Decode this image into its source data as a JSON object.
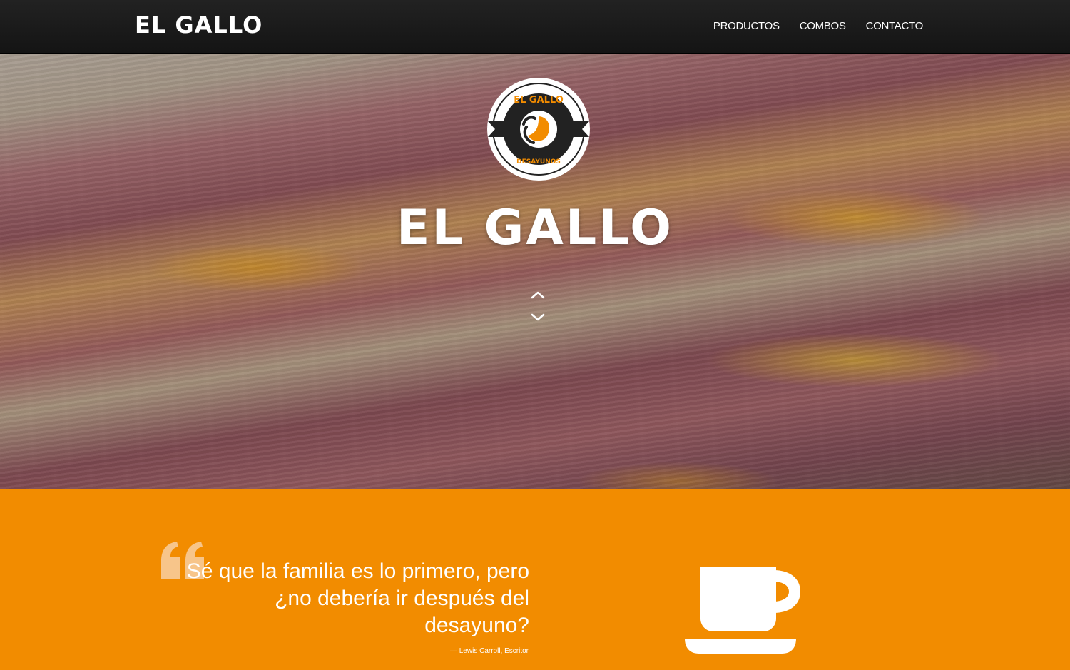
{
  "navbar": {
    "brand": "EL GALLO",
    "links": [
      "PRODUCTOS",
      "COMBOS",
      "CONTACTO"
    ]
  },
  "hero": {
    "logo_top_text": "EL GALLO",
    "logo_bottom_text": "DESAYUNOS",
    "title": "EL GALLO",
    "scroll_icon": "chevron-up-down-icon"
  },
  "quote": {
    "icon": "quote-icon",
    "text": "Sé que la familia es lo primero, pero ¿no debería ir después del desayuno?",
    "author": "— Lewis Carroll, Escritor",
    "side_icon": "coffee-cup-icon"
  },
  "colors": {
    "accent": "#f28c00",
    "navbar": "#1a1a1a",
    "text_light": "#ffffff"
  }
}
